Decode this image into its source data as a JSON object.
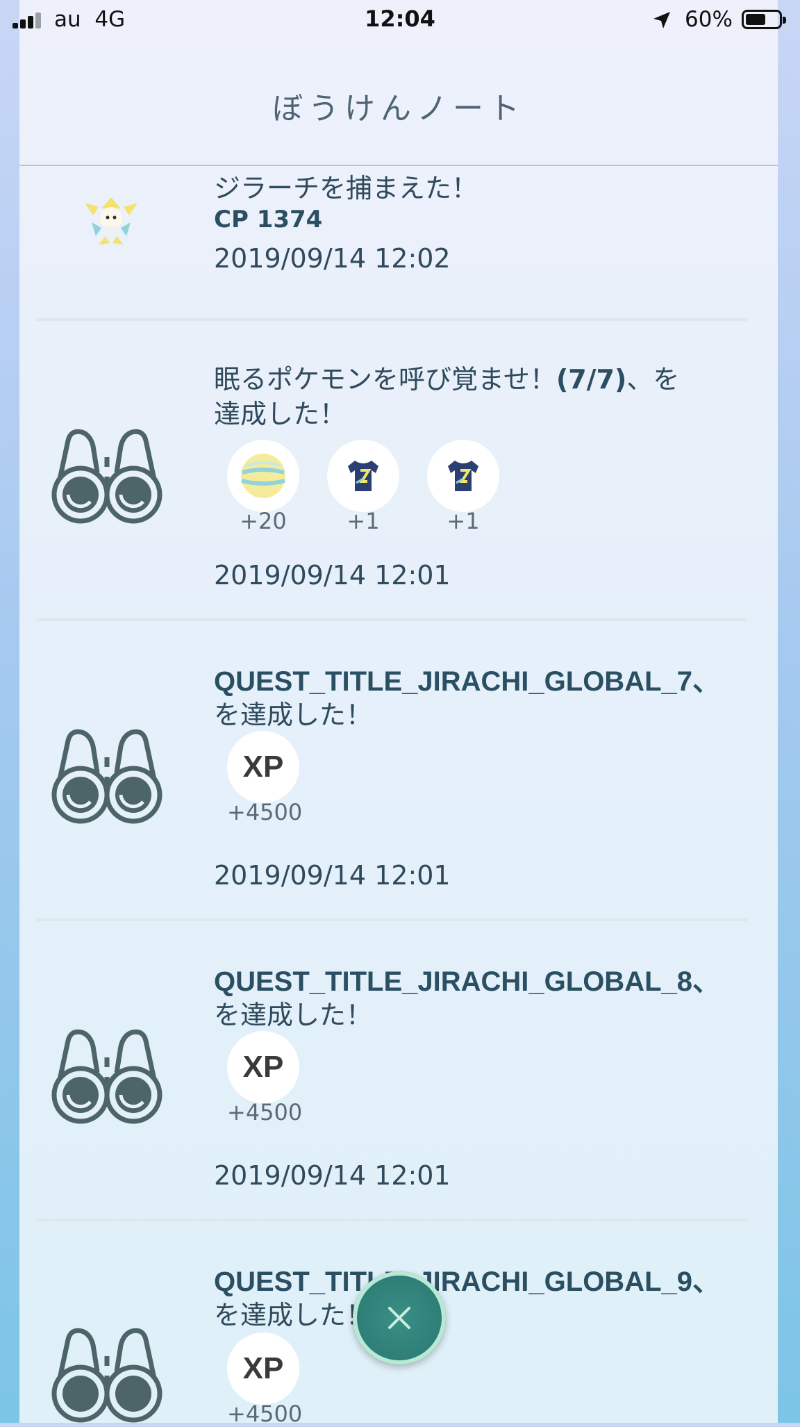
{
  "status_bar": {
    "carrier": "au",
    "network": "4G",
    "time": "12:04",
    "battery_percent": "60%",
    "battery_level": 0.6
  },
  "header": {
    "title": "ぼうけんノート"
  },
  "entries": [
    {
      "type": "catch",
      "title": "ジラーチを捕まえた！",
      "cp": "CP 1374",
      "date": "2019/09/14 12:02",
      "icon": "jirachi-sprite-icon"
    },
    {
      "type": "research",
      "title_line1_prefix": "眠るポケモンを呼び覚ませ！",
      "title_line1_bold": "(7/7)",
      "title_line1_suffix": "、を",
      "title_line2": "達成した！",
      "rewards": [
        {
          "icon": "stardust-ball-icon",
          "amount": "+20"
        },
        {
          "icon": "jirachi-shirt-icon",
          "amount": "+1"
        },
        {
          "icon": "jirachi-shirt-icon",
          "amount": "+1"
        }
      ],
      "date": "2019/09/14 12:01",
      "icon": "binoculars-icon"
    },
    {
      "type": "quest",
      "title_line1": "QUEST_TITLE_JIRACHI_GLOBAL_7、",
      "title_line2": "を達成した！",
      "reward": {
        "label": "XP",
        "amount": "+4500"
      },
      "date": "2019/09/14 12:01",
      "icon": "binoculars-icon"
    },
    {
      "type": "quest",
      "title_line1": "QUEST_TITLE_JIRACHI_GLOBAL_8、",
      "title_line2": "を達成した！",
      "reward": {
        "label": "XP",
        "amount": "+4500"
      },
      "date": "2019/09/14 12:01",
      "icon": "binoculars-icon"
    },
    {
      "type": "quest",
      "title_line1": "QUEST_TITLE_JIRACHI_GLOBAL_9、",
      "title_line2": "を達成した！",
      "reward": {
        "label": "XP",
        "amount": "+4500"
      },
      "icon": "binoculars-icon"
    }
  ],
  "close_button": {
    "icon": "close-icon"
  },
  "colors": {
    "text": "#2f4a5c",
    "close_button": "#2d7d75",
    "icon_gray": "#4d6468"
  }
}
